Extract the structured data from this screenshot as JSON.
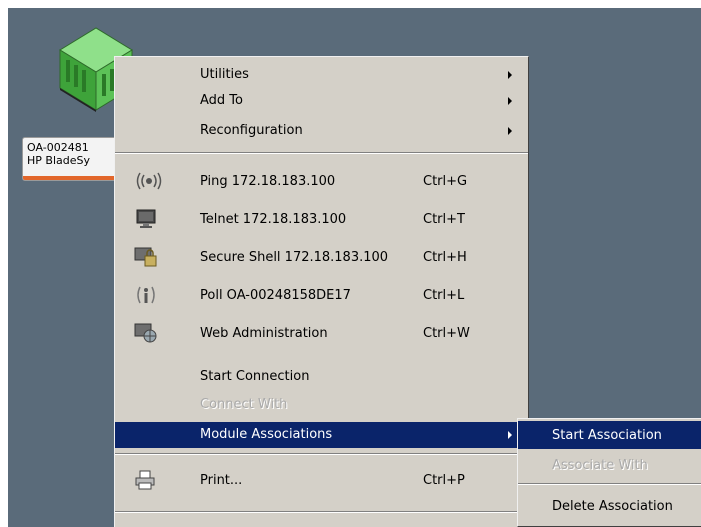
{
  "device": {
    "icon": "server-chassis-icon",
    "label_line1": "OA-002481",
    "label_line2": "HP BladeSy"
  },
  "menu": {
    "items": [
      {
        "label": "Utilities",
        "submenu": true
      },
      {
        "label": "Add To",
        "submenu": true
      },
      {
        "label": "Reconfiguration",
        "submenu": true
      },
      {
        "label": "Ping 172.18.183.100",
        "shortcut": "Ctrl+G",
        "icon": "ping-icon"
      },
      {
        "label": "Telnet 172.18.183.100",
        "shortcut": "Ctrl+T",
        "icon": "monitor-icon"
      },
      {
        "label": "Secure Shell 172.18.183.100",
        "shortcut": "Ctrl+H",
        "icon": "lock-monitor-icon"
      },
      {
        "label": "Poll OA-00248158DE17",
        "shortcut": "Ctrl+L",
        "icon": "poll-icon"
      },
      {
        "label": "Web Administration",
        "shortcut": "Ctrl+W",
        "icon": "web-admin-icon"
      },
      {
        "label": "Start Connection"
      },
      {
        "label": "Connect With",
        "disabled": true
      },
      {
        "label": "Module Associations",
        "submenu": true,
        "highlighted": true
      },
      {
        "label": "Print...",
        "shortcut": "Ctrl+P",
        "icon": "printer-icon"
      }
    ]
  },
  "submenu": {
    "items": [
      {
        "label": "Start Association",
        "highlighted": true
      },
      {
        "label": "Associate With",
        "disabled": true
      },
      {
        "label": "Delete Association"
      }
    ]
  },
  "colors": {
    "canvas": "#5a6b7a",
    "menu_bg": "#d4d0c8",
    "highlight": "#0a246a",
    "label_accent": "#e2662a"
  }
}
